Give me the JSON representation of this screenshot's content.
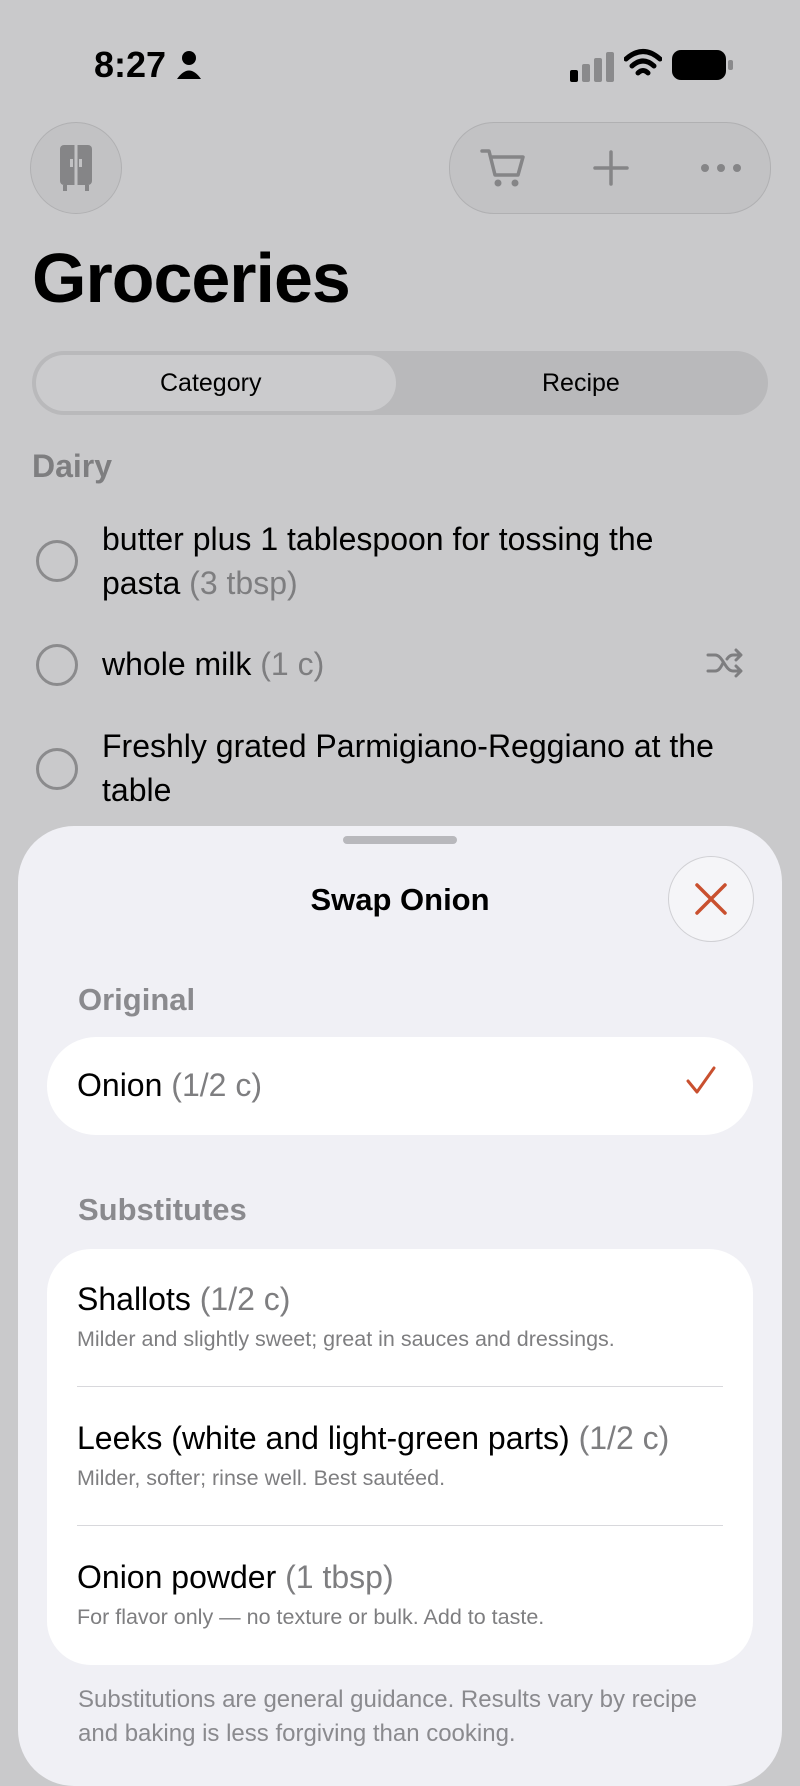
{
  "status": {
    "time": "8:27"
  },
  "toolbar": {
    "left": "fridge-icon",
    "icons": [
      "cart-icon",
      "plus-icon",
      "more-icon"
    ]
  },
  "page": {
    "title": "Groceries"
  },
  "segments": {
    "category": "Category",
    "recipe": "Recipe",
    "selected": "Category"
  },
  "section": {
    "title": "Dairy"
  },
  "list": [
    {
      "name": "butter plus 1 tablespoon for tossing the pasta",
      "qty": "(3 tbsp)"
    },
    {
      "name": "whole milk",
      "qty": "(1 c)"
    },
    {
      "name": "Freshly grated Parmigiano-Reggiano at the table",
      "qty": ""
    }
  ],
  "sheet": {
    "title": "Swap Onion",
    "original_label": "Original",
    "original": {
      "name": "Onion",
      "qty": "(1/2 c)"
    },
    "substitutes_label": "Substitutes",
    "substitutes": [
      {
        "name": "Shallots",
        "qty": "(1/2 c)",
        "desc": "Milder and slightly sweet; great in sauces and dressings."
      },
      {
        "name": "Leeks (white and light-green parts)",
        "qty": "(1/2 c)",
        "desc": "Milder, softer; rinse well. Best sautéed."
      },
      {
        "name": "Onion powder",
        "qty": "(1 tbsp)",
        "desc": "For flavor only — no texture or bulk. Add to taste."
      }
    ],
    "footer": "Substitutions are general guidance. Results vary by recipe and baking is less forgiving than cooking."
  },
  "colors": {
    "accent": "#c9502f",
    "background": "#c9c9cb",
    "sheet": "#f0f0f5"
  }
}
